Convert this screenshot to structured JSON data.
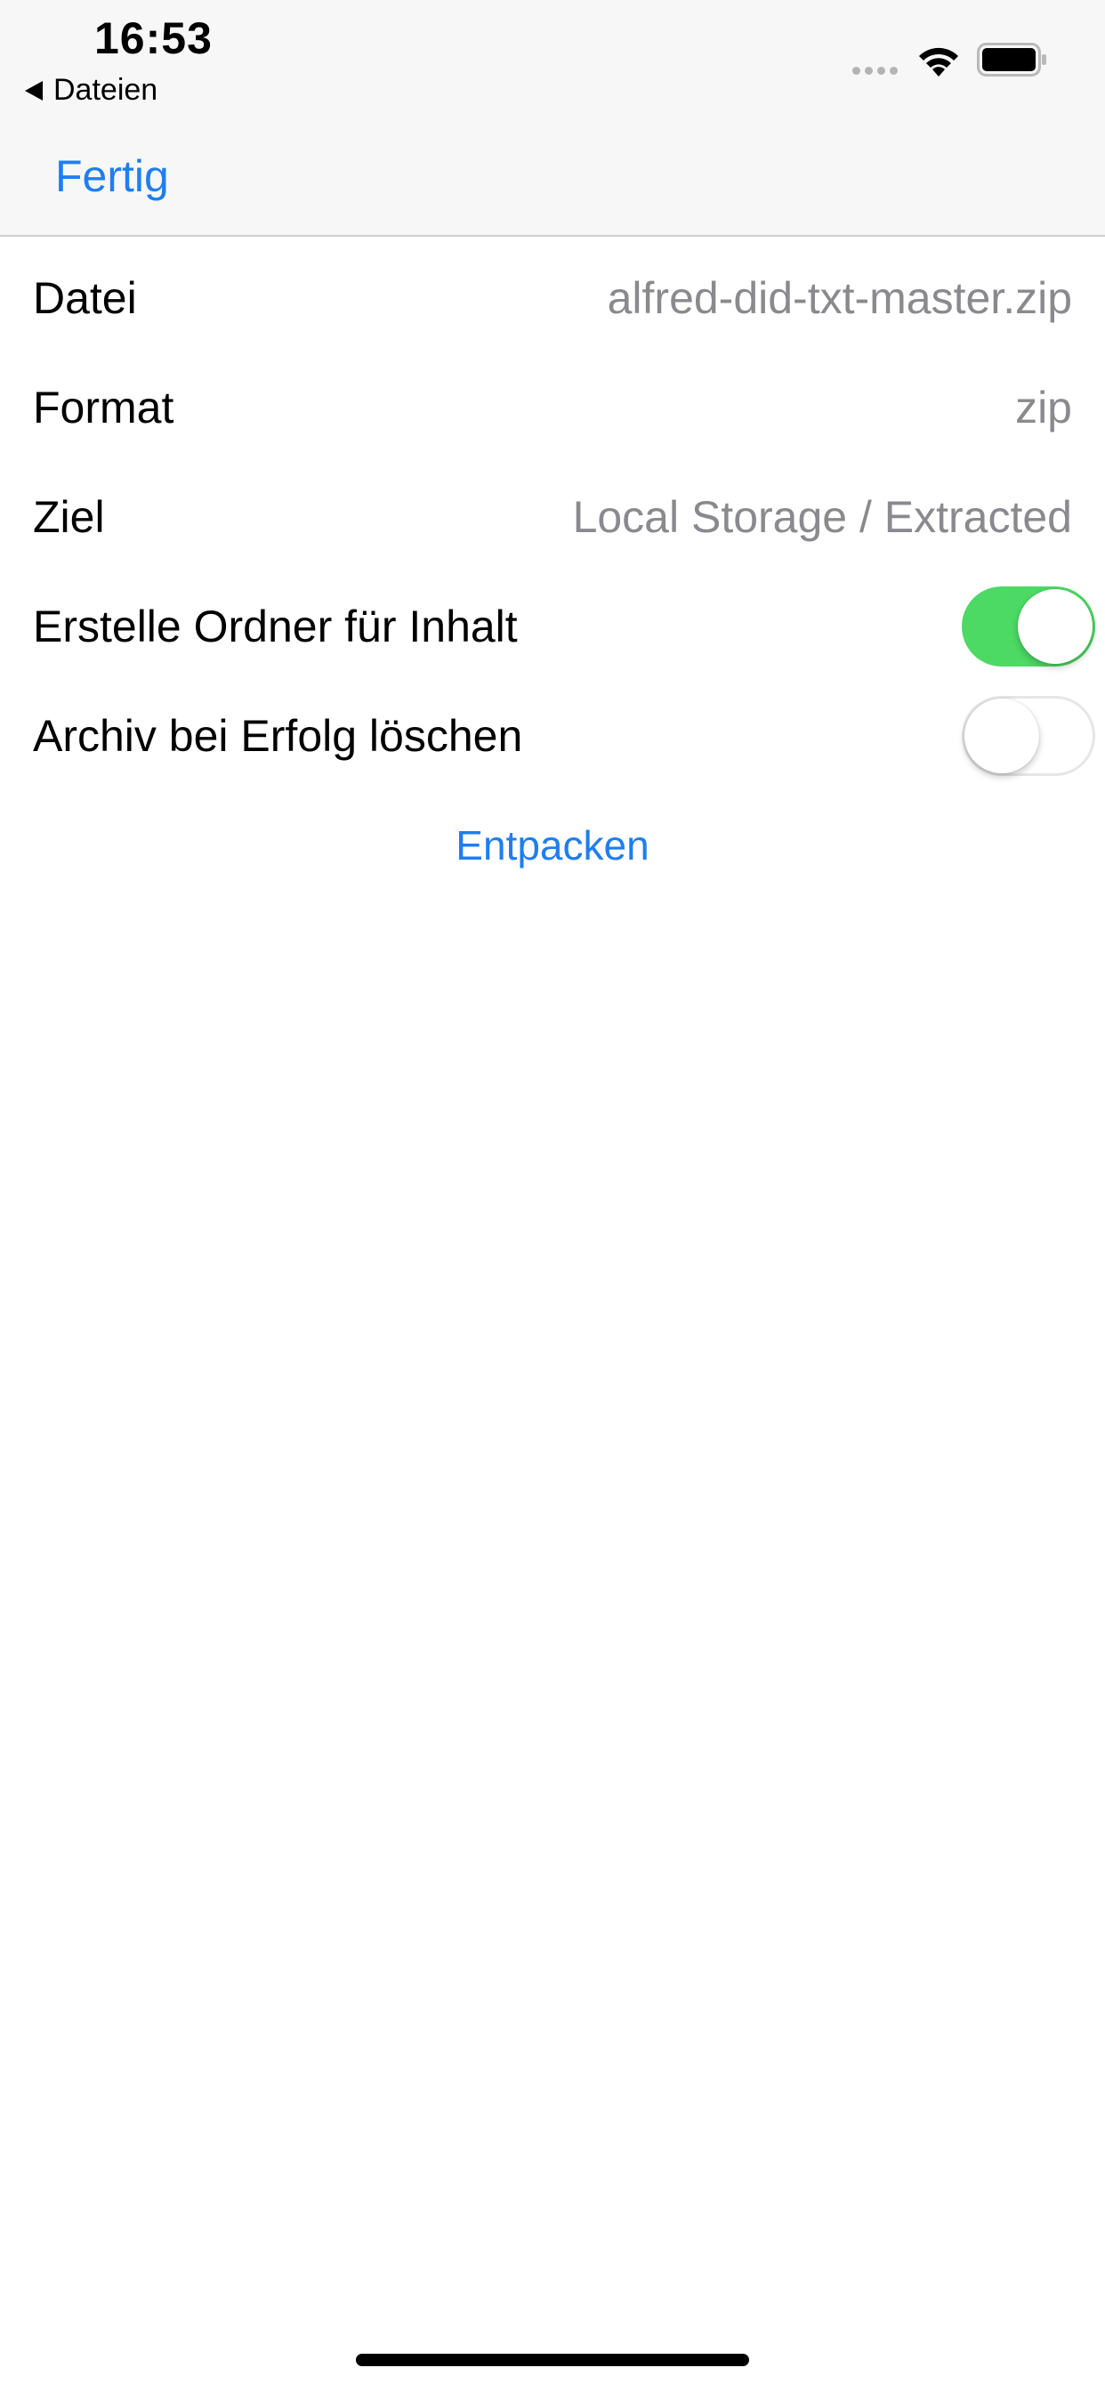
{
  "status_bar": {
    "time": "16:53",
    "back_app": "Dateien",
    "wifi_icon": "wifi-icon",
    "battery_icon": "battery-icon",
    "signal_icon": "signal-dots-icon"
  },
  "nav": {
    "done_label": "Fertig"
  },
  "form": {
    "rows": [
      {
        "label": "Datei",
        "value": "alfred-did-txt-master.zip"
      },
      {
        "label": "Format",
        "value": "zip"
      },
      {
        "label": "Ziel",
        "value": "Local Storage / Extracted"
      }
    ],
    "toggles": [
      {
        "label": "Erstelle Ordner für Inhalt",
        "on": true
      },
      {
        "label": "Archiv bei Erfolg löschen",
        "on": false
      }
    ],
    "action_label": "Entpacken"
  },
  "colors": {
    "accent": "#1f7ef0",
    "toggle_on": "#4cd964",
    "secondary_text": "#8a8a8e"
  }
}
